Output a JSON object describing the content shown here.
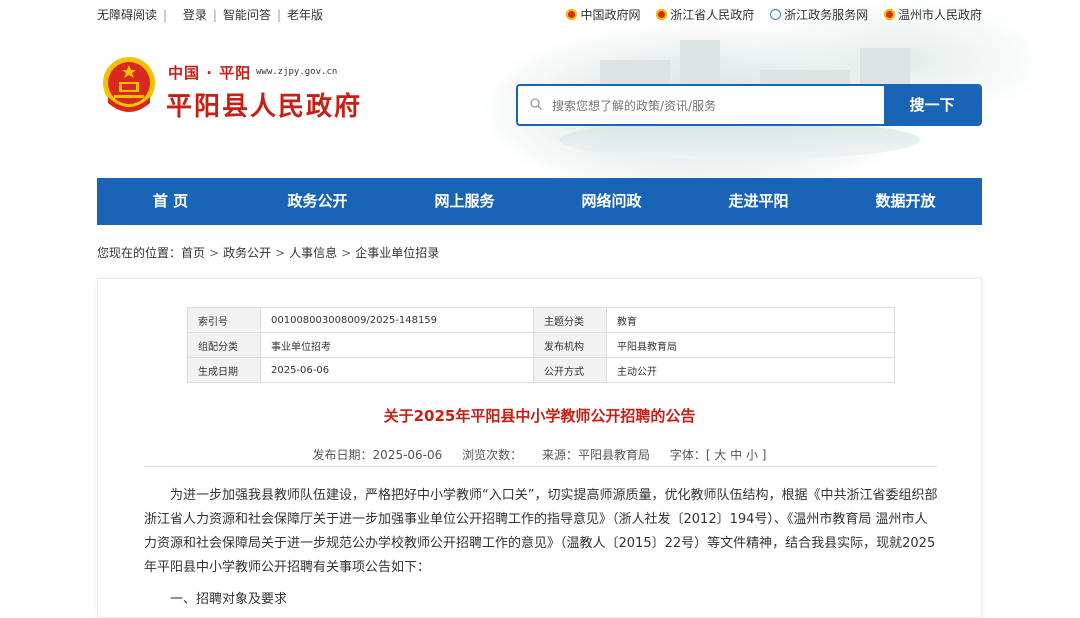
{
  "topbar": {
    "accessibility": "无障碍阅读",
    "login": "登录",
    "smart_qa": "智能问答",
    "elderly": "老年版",
    "links": [
      "中国政府网",
      "浙江省人民政府",
      "浙江政务服务网",
      "温州市人民政府"
    ]
  },
  "brand": {
    "sub": "中国 · 平阳",
    "url": "www.zjpy.gov.cn",
    "title": "平阳县人民政府"
  },
  "search": {
    "placeholder": "搜索您想了解的政策/资讯/服务",
    "button": "搜一下"
  },
  "nav": [
    "首 页",
    "政务公开",
    "网上服务",
    "网络问政",
    "走进平阳",
    "数据开放"
  ],
  "breadcrumb": {
    "prefix": "您现在的位置：",
    "items": [
      "首页",
      "政务公开",
      "人事信息",
      "企事业单位招录"
    ]
  },
  "meta": {
    "index_label": "索引号",
    "index_value": "001008003008009/2025-148159",
    "topic_label": "主题分类",
    "topic_value": "教育",
    "category_label": "组配分类",
    "category_value": "事业单位招考",
    "publisher_label": "发布机构",
    "publisher_value": "平阳县教育局",
    "date_label": "生成日期",
    "date_value": "2025-06-06",
    "mode_label": "公开方式",
    "mode_value": "主动公开"
  },
  "article": {
    "title": "关于2025年平阳县中小学教师公开招聘的公告",
    "publish_date": "发布日期：2025-06-06",
    "views": "浏览次数：",
    "source": "来源：平阳县教育局",
    "font_size": "字体：[ 大 中 小 ]",
    "paragraph": "为进一步加强我县教师队伍建设，严格把好中小学教师“入口关”，切实提高师源质量，优化教师队伍结构，根据《中共浙江省委组织部 浙江省人力资源和社会保障厅关于进一步加强事业单位公开招聘工作的指导意见》（浙人社发〔2012〕194号）、《温州市教育局 温州市人力资源和社会保障局关于进一步规范公办学校教师公开招聘工作的意见》（温教人〔2015〕22号）等文件精神，结合我县实际，现就2025年平阳县中小学教师公开招聘有关事项公告如下：",
    "heading": "一、招聘对象及要求"
  }
}
